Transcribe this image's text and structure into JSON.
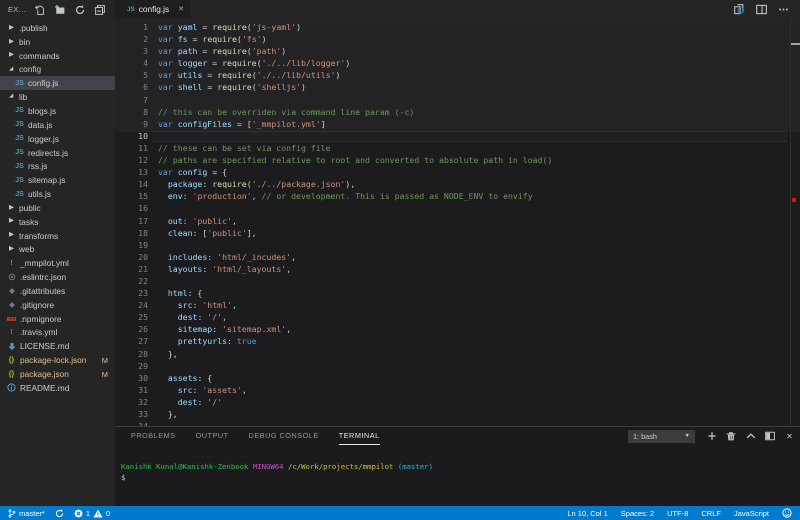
{
  "explorer": {
    "title": "EX...",
    "actions": [
      "new-file",
      "new-folder",
      "refresh",
      "collapse-all"
    ],
    "items": [
      {
        "kind": "folder",
        "label": ".publish",
        "state": "collapsed"
      },
      {
        "kind": "folder",
        "label": "bin",
        "state": "collapsed"
      },
      {
        "kind": "folder",
        "label": "commands",
        "state": "collapsed"
      },
      {
        "kind": "folder",
        "label": "config",
        "state": "expanded"
      },
      {
        "kind": "file",
        "label": "config.js",
        "icon": "js",
        "depth": 1,
        "selected": true
      },
      {
        "kind": "folder",
        "label": "lib",
        "state": "expanded"
      },
      {
        "kind": "file",
        "label": "blogs.js",
        "icon": "js",
        "depth": 1
      },
      {
        "kind": "file",
        "label": "data.js",
        "icon": "js",
        "depth": 1
      },
      {
        "kind": "file",
        "label": "logger.js",
        "icon": "js",
        "depth": 1
      },
      {
        "kind": "file",
        "label": "redirects.js",
        "icon": "js",
        "depth": 1
      },
      {
        "kind": "file",
        "label": "rss.js",
        "icon": "js",
        "depth": 1
      },
      {
        "kind": "file",
        "label": "sitemap.js",
        "icon": "js",
        "depth": 1
      },
      {
        "kind": "file",
        "label": "utils.js",
        "icon": "js",
        "depth": 1
      },
      {
        "kind": "folder",
        "label": "public",
        "state": "collapsed"
      },
      {
        "kind": "folder",
        "label": "tasks",
        "state": "collapsed"
      },
      {
        "kind": "folder",
        "label": "transforms",
        "state": "collapsed"
      },
      {
        "kind": "folder",
        "label": "web",
        "state": "collapsed"
      },
      {
        "kind": "file",
        "label": "_mmpilot.yml",
        "icon": "excl",
        "depth": 0
      },
      {
        "kind": "file",
        "label": ".eslintrc.json",
        "icon": "gear",
        "depth": 0
      },
      {
        "kind": "file",
        "label": ".gitattributes",
        "icon": "diamond",
        "depth": 0
      },
      {
        "kind": "file",
        "label": ".gitignore",
        "icon": "diamond",
        "depth": 0
      },
      {
        "kind": "file",
        "label": ".npmignore",
        "icon": "npm",
        "depth": 0
      },
      {
        "kind": "file",
        "label": ".travis.yml",
        "icon": "excl",
        "depth": 0
      },
      {
        "kind": "file",
        "label": "LICENSE.md",
        "icon": "mdarrow",
        "depth": 0
      },
      {
        "kind": "file",
        "label": "package-lock.json",
        "icon": "braces",
        "depth": 0,
        "badge": "M",
        "modified": true
      },
      {
        "kind": "file",
        "label": "package.json",
        "icon": "braces",
        "depth": 0,
        "badge": "M",
        "modified": true
      },
      {
        "kind": "file",
        "label": "README.md",
        "icon": "info",
        "depth": 0
      }
    ]
  },
  "tab": {
    "label": "config.js",
    "icon": "js"
  },
  "editor": {
    "current_line": 10,
    "lines": [
      {
        "n": 1,
        "t": [
          [
            "k",
            "var"
          ],
          [
            "w",
            " "
          ],
          [
            "v",
            "yaml"
          ],
          [
            "w",
            " = "
          ],
          [
            "f",
            "require"
          ],
          [
            "w",
            "("
          ],
          [
            "s",
            "'js-yaml'"
          ],
          [
            "w",
            ")"
          ]
        ]
      },
      {
        "n": 2,
        "t": [
          [
            "k",
            "var"
          ],
          [
            "w",
            " "
          ],
          [
            "v",
            "fs"
          ],
          [
            "w",
            " = "
          ],
          [
            "f",
            "require"
          ],
          [
            "w",
            "("
          ],
          [
            "s",
            "'fs'"
          ],
          [
            "w",
            ")"
          ]
        ]
      },
      {
        "n": 3,
        "t": [
          [
            "k",
            "var"
          ],
          [
            "w",
            " "
          ],
          [
            "v",
            "path"
          ],
          [
            "w",
            " = "
          ],
          [
            "f",
            "require"
          ],
          [
            "w",
            "("
          ],
          [
            "s",
            "'path'"
          ],
          [
            "w",
            ")"
          ]
        ]
      },
      {
        "n": 4,
        "t": [
          [
            "k",
            "var"
          ],
          [
            "w",
            " "
          ],
          [
            "v",
            "logger"
          ],
          [
            "w",
            " = "
          ],
          [
            "f",
            "require"
          ],
          [
            "w",
            "("
          ],
          [
            "s",
            "'./../lib/logger'"
          ],
          [
            "w",
            ")"
          ]
        ]
      },
      {
        "n": 5,
        "t": [
          [
            "k",
            "var"
          ],
          [
            "w",
            " "
          ],
          [
            "v",
            "utils"
          ],
          [
            "w",
            " = "
          ],
          [
            "f",
            "require"
          ],
          [
            "w",
            "("
          ],
          [
            "s",
            "'./../lib/utils'"
          ],
          [
            "w",
            ")"
          ]
        ]
      },
      {
        "n": 6,
        "t": [
          [
            "k",
            "var"
          ],
          [
            "w",
            " "
          ],
          [
            "v",
            "shell"
          ],
          [
            "w",
            " = "
          ],
          [
            "f",
            "require"
          ],
          [
            "w",
            "("
          ],
          [
            "s",
            "'shelljs'"
          ],
          [
            "w",
            ")"
          ]
        ]
      },
      {
        "n": 7,
        "t": []
      },
      {
        "n": 8,
        "t": [
          [
            "c",
            "// this can be overriden via command line param (-c)"
          ]
        ]
      },
      {
        "n": 9,
        "t": [
          [
            "k",
            "var"
          ],
          [
            "w",
            " "
          ],
          [
            "v",
            "configFiles"
          ],
          [
            "w",
            " = ["
          ],
          [
            "s",
            "'_mmpilot.yml'"
          ],
          [
            "w",
            "]"
          ]
        ]
      },
      {
        "n": 10,
        "t": [],
        "current": true
      },
      {
        "n": 11,
        "t": [
          [
            "c",
            "// these can be set via config file"
          ]
        ]
      },
      {
        "n": 12,
        "t": [
          [
            "c",
            "// paths are specified relative to root and converted to absolute path in load()"
          ]
        ]
      },
      {
        "n": 13,
        "t": [
          [
            "k",
            "var"
          ],
          [
            "w",
            " "
          ],
          [
            "v",
            "config"
          ],
          [
            "w",
            " = {"
          ]
        ]
      },
      {
        "n": 14,
        "t": [
          [
            "w",
            "  "
          ],
          [
            "v",
            "package"
          ],
          [
            "w",
            ": "
          ],
          [
            "f",
            "require"
          ],
          [
            "w",
            "("
          ],
          [
            "s",
            "'./../package.json'"
          ],
          [
            "w",
            "),"
          ]
        ]
      },
      {
        "n": 15,
        "t": [
          [
            "w",
            "  "
          ],
          [
            "v",
            "env"
          ],
          [
            "w",
            ": "
          ],
          [
            "s",
            "'production'"
          ],
          [
            "w",
            ", "
          ],
          [
            "c",
            "// or development. This is passed as NODE_ENV to envify"
          ]
        ]
      },
      {
        "n": 16,
        "t": []
      },
      {
        "n": 17,
        "t": [
          [
            "w",
            "  "
          ],
          [
            "v",
            "out"
          ],
          [
            "w",
            ": "
          ],
          [
            "s",
            "'public'"
          ],
          [
            "w",
            ","
          ]
        ]
      },
      {
        "n": 18,
        "t": [
          [
            "w",
            "  "
          ],
          [
            "v",
            "clean"
          ],
          [
            "w",
            ": ["
          ],
          [
            "s",
            "'public'"
          ],
          [
            "w",
            "],"
          ]
        ]
      },
      {
        "n": 19,
        "t": []
      },
      {
        "n": 20,
        "t": [
          [
            "w",
            "  "
          ],
          [
            "v",
            "includes"
          ],
          [
            "w",
            ": "
          ],
          [
            "s",
            "'html/_incudes'"
          ],
          [
            "w",
            ","
          ]
        ]
      },
      {
        "n": 21,
        "t": [
          [
            "w",
            "  "
          ],
          [
            "v",
            "layouts"
          ],
          [
            "w",
            ": "
          ],
          [
            "s",
            "'html/_layouts'"
          ],
          [
            "w",
            ","
          ]
        ]
      },
      {
        "n": 22,
        "t": []
      },
      {
        "n": 23,
        "t": [
          [
            "w",
            "  "
          ],
          [
            "v",
            "html"
          ],
          [
            "w",
            ": {"
          ]
        ]
      },
      {
        "n": 24,
        "t": [
          [
            "w",
            "    "
          ],
          [
            "v",
            "src"
          ],
          [
            "w",
            ": "
          ],
          [
            "s",
            "'html'"
          ],
          [
            "w",
            ","
          ]
        ]
      },
      {
        "n": 25,
        "t": [
          [
            "w",
            "    "
          ],
          [
            "v",
            "dest"
          ],
          [
            "w",
            ": "
          ],
          [
            "s",
            "'/'"
          ],
          [
            "w",
            ","
          ]
        ]
      },
      {
        "n": 26,
        "t": [
          [
            "w",
            "    "
          ],
          [
            "v",
            "sitemap"
          ],
          [
            "w",
            ": "
          ],
          [
            "s",
            "'sitemap.xml'"
          ],
          [
            "w",
            ","
          ]
        ]
      },
      {
        "n": 27,
        "t": [
          [
            "w",
            "    "
          ],
          [
            "v",
            "prettyurls"
          ],
          [
            "w",
            ": "
          ],
          [
            "k",
            "true"
          ]
        ]
      },
      {
        "n": 28,
        "t": [
          [
            "w",
            "  },"
          ]
        ]
      },
      {
        "n": 29,
        "t": []
      },
      {
        "n": 30,
        "t": [
          [
            "w",
            "  "
          ],
          [
            "v",
            "assets"
          ],
          [
            "w",
            ": {"
          ]
        ]
      },
      {
        "n": 31,
        "t": [
          [
            "w",
            "    "
          ],
          [
            "v",
            "src"
          ],
          [
            "w",
            ": "
          ],
          [
            "s",
            "'assets'"
          ],
          [
            "w",
            ","
          ]
        ]
      },
      {
        "n": 32,
        "t": [
          [
            "w",
            "    "
          ],
          [
            "v",
            "dest"
          ],
          [
            "w",
            ": "
          ],
          [
            "s",
            "'/'"
          ]
        ]
      },
      {
        "n": 33,
        "t": [
          [
            "w",
            "  },"
          ]
        ]
      },
      {
        "n": 34,
        "t": []
      }
    ]
  },
  "panel": {
    "tabs": [
      "PROBLEMS",
      "OUTPUT",
      "DEBUG CONSOLE",
      "TERMINAL"
    ],
    "active_tab": "TERMINAL",
    "terminal_select": "1: bash",
    "terminal_lines": [
      [
        [
          "tgreen",
          "Kanishk Kunal@Kanishk-Zenbook"
        ],
        [
          "tw",
          " "
        ],
        [
          "tmagenta",
          "MINGW64"
        ],
        [
          "tw",
          " "
        ],
        [
          "tyellow",
          "/c/Work/projects/mmpilot"
        ],
        [
          "tw",
          " "
        ],
        [
          "tcyan",
          "(master)"
        ]
      ],
      [
        [
          "tw",
          "$"
        ]
      ]
    ]
  },
  "statusbar": {
    "branch": "master*",
    "errors": "1",
    "warnings": "0",
    "cursor": "Ln 10, Col 1",
    "indent": "Spaces: 2",
    "encoding": "UTF-8",
    "eol": "CRLF",
    "language": "JavaScript"
  },
  "colors": {
    "statusbar_bg": "#007acc",
    "editor_bg": "#1e1e1e",
    "sidebar_bg": "#252526",
    "keyword": "#569cd6",
    "variable": "#9cdcfe",
    "function": "#dcdcaa",
    "string": "#ce9178",
    "comment": "#6a9955",
    "error_mark": "#e51400",
    "modified_badge": "#e2c08d"
  }
}
